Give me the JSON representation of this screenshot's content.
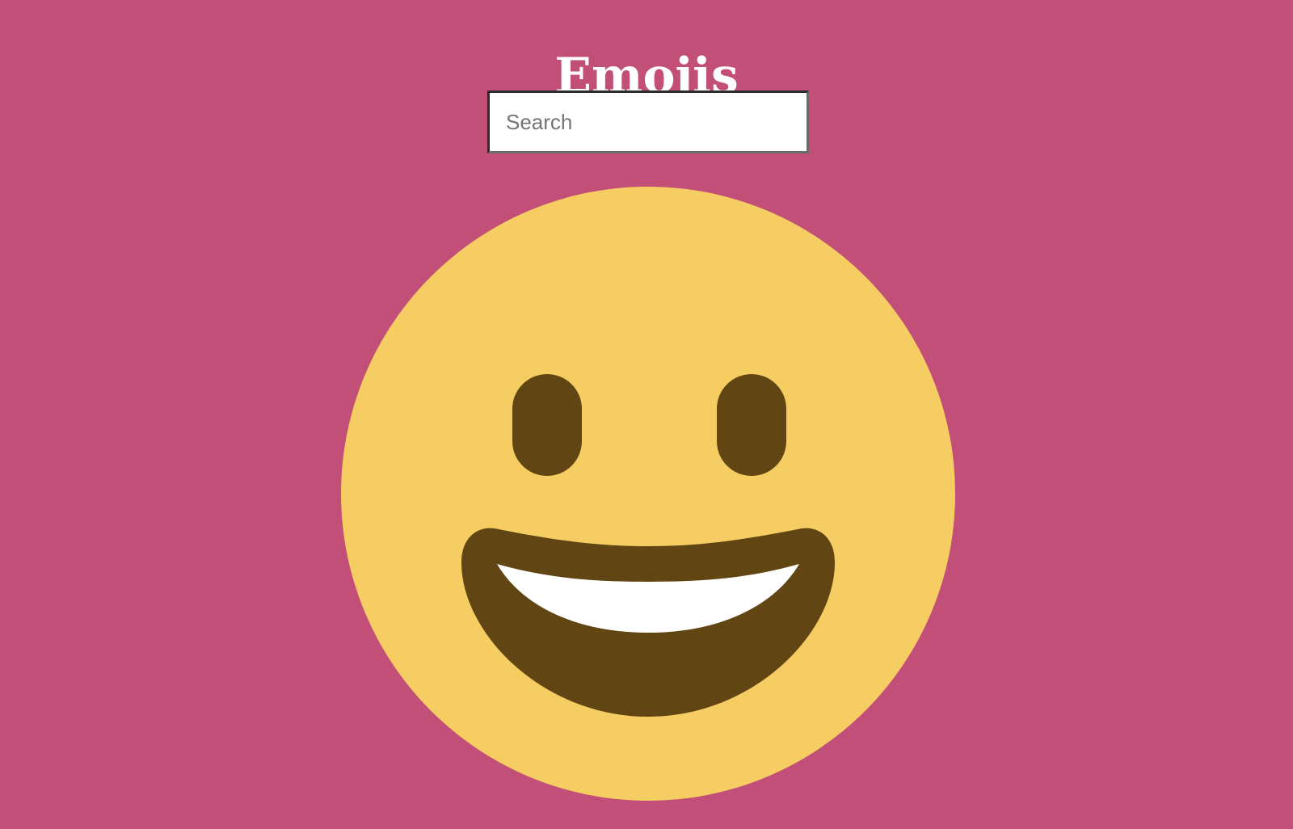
{
  "header": {
    "title": "Emojis"
  },
  "search": {
    "placeholder": "Search",
    "value": ""
  },
  "emoji": {
    "name": "grinning-face",
    "colors": {
      "face": "#f6cd63",
      "features": "#614512",
      "teeth": "#ffffff"
    }
  },
  "theme": {
    "background": "#c24f77",
    "title_color": "#ffffff"
  }
}
